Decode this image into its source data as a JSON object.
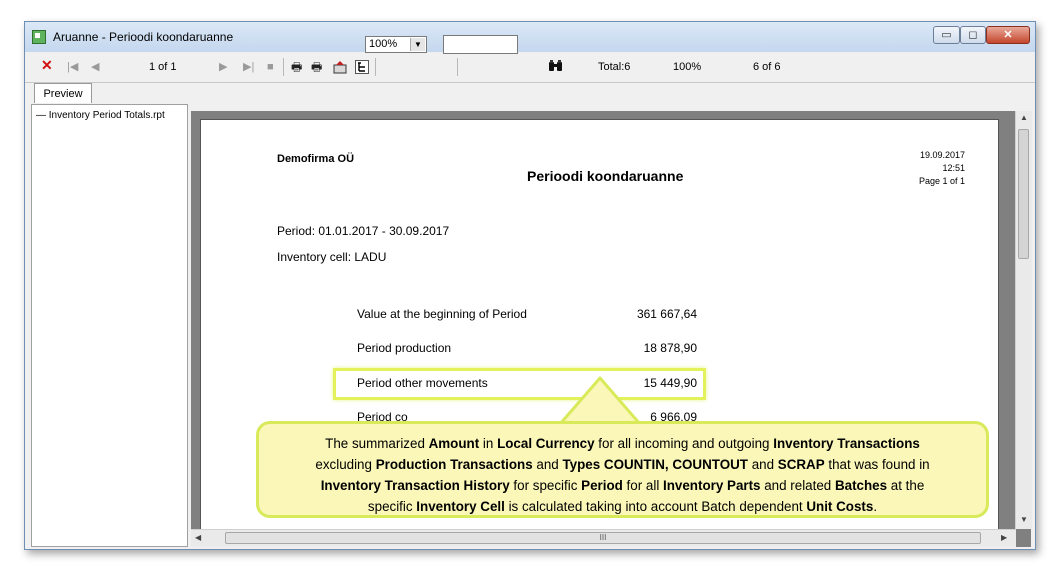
{
  "window": {
    "title": "Aruanne - Perioodi koondaruanne",
    "controls": {
      "minimize": "▭",
      "maximize": "◻",
      "close": "✕"
    }
  },
  "toolbar": {
    "close_icon": "✕",
    "first_icon": "|◀",
    "prev_icon": "◀",
    "page_indicator": "1 of 1",
    "next_icon": "▶",
    "last_icon": "▶|",
    "stop_icon": "■",
    "print_icon": "🖶",
    "zoom_value": "100%",
    "search_icon": "🔍",
    "total": "Total:6",
    "percent": "100%",
    "records": "6 of 6"
  },
  "tabs": {
    "preview": "Preview"
  },
  "tree": {
    "items": [
      "Inventory Period Totals.rpt"
    ]
  },
  "report": {
    "company": "Demofirma OÜ",
    "title": "Perioodi koondaruanne",
    "date": "19.09.2017",
    "time": "12:51",
    "page": "Page 1 of 1",
    "period": "Period: 01.01.2017 - 30.09.2017",
    "inventory_cell": "Inventory cell: LADU",
    "rows": [
      {
        "label": "Value at the beginning of Period",
        "value": "361 667,64"
      },
      {
        "label": "Period production",
        "value": "18 878,90"
      },
      {
        "label": "Period other movements",
        "value": "15 449,90"
      },
      {
        "label": "Period co",
        "value": "6 966,09"
      }
    ]
  },
  "callout": {
    "lines": [
      "The summarized Amount in Local Currency for all incoming and outgoing Inventory Transactions",
      "excluding Production Transactions and Types COUNTIN, COUNTOUT and SCRAP that was found in",
      "Inventory Transaction History for specific Period for all Inventory Parts and related Batches at the",
      "specific Inventory Cell is calculated taking into account Batch dependent Unit Costs."
    ]
  },
  "colors": {
    "highlight": "#e3f25a",
    "callout_bg": "#faf7b8",
    "close_button": "#c4452c"
  }
}
